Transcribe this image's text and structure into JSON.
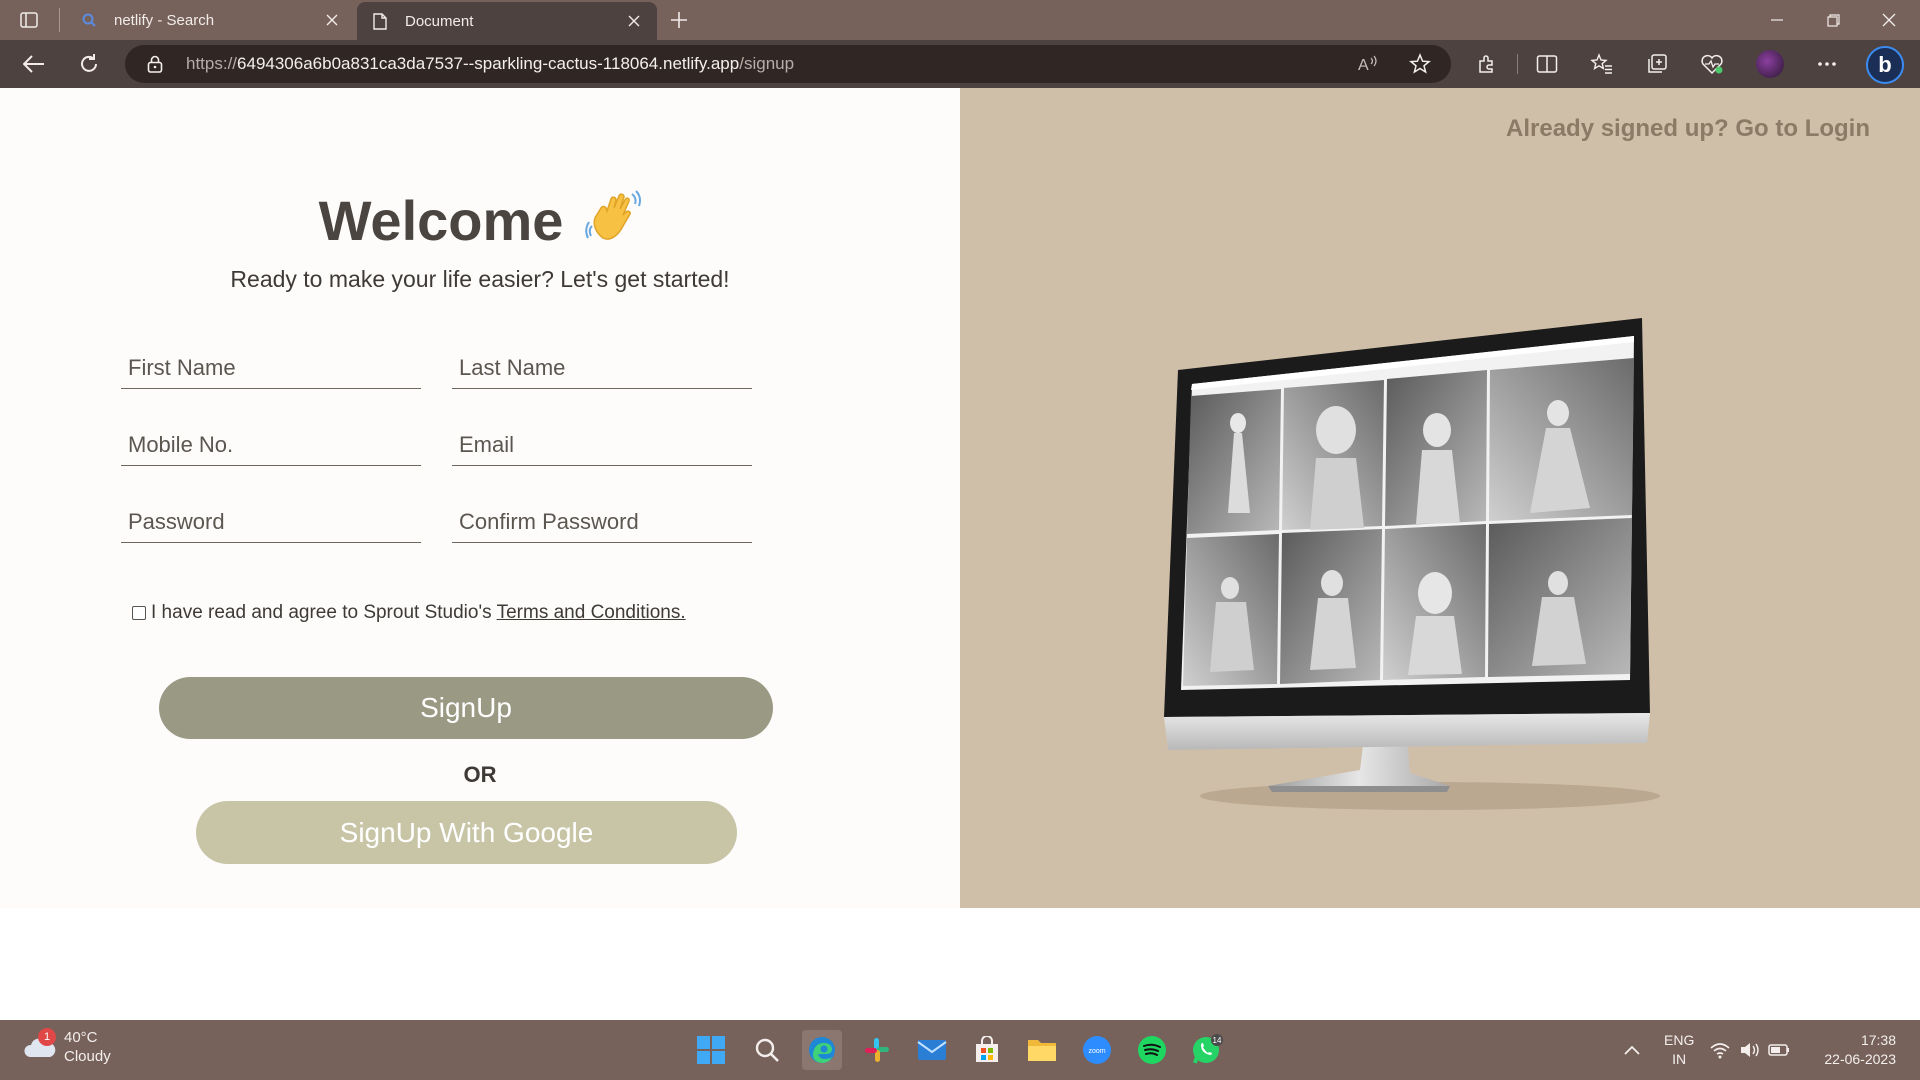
{
  "browser": {
    "tabs": [
      {
        "title": "netlify - Search",
        "active": false
      },
      {
        "title": "Document",
        "active": true
      }
    ],
    "url_prefix": "https://",
    "url_host": "6494306a6b0a831ca3da7537--sparkling-cactus-118064.netlify.app",
    "url_path": "/signup"
  },
  "page": {
    "welcome_title": "Welcome",
    "subtitle": "Ready to make your life easier? Let's get started!",
    "fields": {
      "first_name": "First Name",
      "last_name": "Last Name",
      "mobile": "Mobile No.",
      "email": "Email",
      "password": "Password",
      "confirm_password": "Confirm Password"
    },
    "terms_text": "I have read and agree to Sprout Studio's",
    "terms_link": "Terms and Conditions.",
    "signup_button": "SignUp",
    "or_text": "OR",
    "google_button": "SignUp With Google",
    "login_link": "Already signed up? Go to Login"
  },
  "taskbar": {
    "weather_temp": "40°C",
    "weather_desc": "Cloudy",
    "weather_badge": "1",
    "whatsapp_badge": "14",
    "lang_line1": "ENG",
    "lang_line2": "IN",
    "time": "17:38",
    "date": "22-06-2023"
  },
  "colors": {
    "tabbar_bg": "#76625b",
    "navbar_bg": "#4e4240",
    "right_panel_bg": "#d0bfa8",
    "signup_button_bg": "#9a9a84",
    "google_button_bg": "#c8c5a7",
    "login_link": "#8a7a66"
  }
}
